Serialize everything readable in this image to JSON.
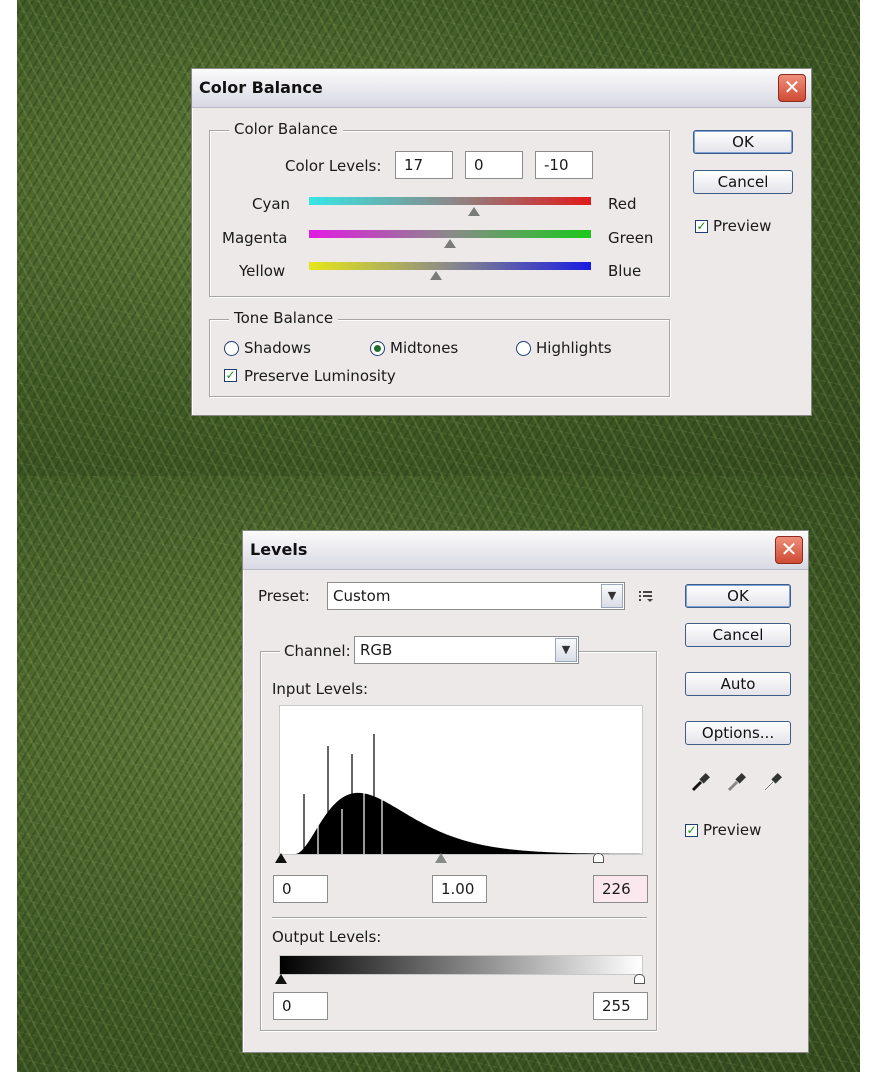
{
  "color_balance": {
    "title": "Color Balance",
    "close_glyph": "✕",
    "group_color_balance": "Color Balance",
    "color_levels_label": "Color Levels:",
    "color_levels": [
      "17",
      "0",
      "-10"
    ],
    "sliders": [
      {
        "left": "Cyan",
        "right": "Red",
        "value": 17,
        "from": "#36e6e6",
        "to": "#e21a1a"
      },
      {
        "left": "Magenta",
        "right": "Green",
        "value": 0,
        "from": "#e21ae2",
        "to": "#1ac81a"
      },
      {
        "left": "Yellow",
        "right": "Blue",
        "value": -10,
        "from": "#e6e61a",
        "to": "#1a1ae2"
      }
    ],
    "slider_range": [
      -100,
      100
    ],
    "group_tone_balance": "Tone Balance",
    "tone_options": [
      "Shadows",
      "Midtones",
      "Highlights"
    ],
    "tone_selected": "Midtones",
    "preserve_luminosity": "Preserve Luminosity",
    "ok": "OK",
    "cancel": "Cancel",
    "preview": "Preview"
  },
  "levels": {
    "title": "Levels",
    "close_glyph": "✕",
    "preset_label": "Preset:",
    "preset_value": "Custom",
    "channel_label": "Channel:",
    "channel_value": "RGB",
    "input_levels_label": "Input Levels:",
    "input_black": "0",
    "input_gamma": "1.00",
    "input_white": "226",
    "output_levels_label": "Output Levels:",
    "output_black": "0",
    "output_white": "255",
    "ok": "OK",
    "cancel": "Cancel",
    "auto": "Auto",
    "options": "Options...",
    "preview": "Preview",
    "input_white_highlight": "#fbe8ee",
    "icons": [
      "black-eyedropper-icon",
      "gray-eyedropper-icon",
      "white-eyedropper-icon",
      "preset-menu-icon",
      "chevron-down-icon"
    ]
  }
}
